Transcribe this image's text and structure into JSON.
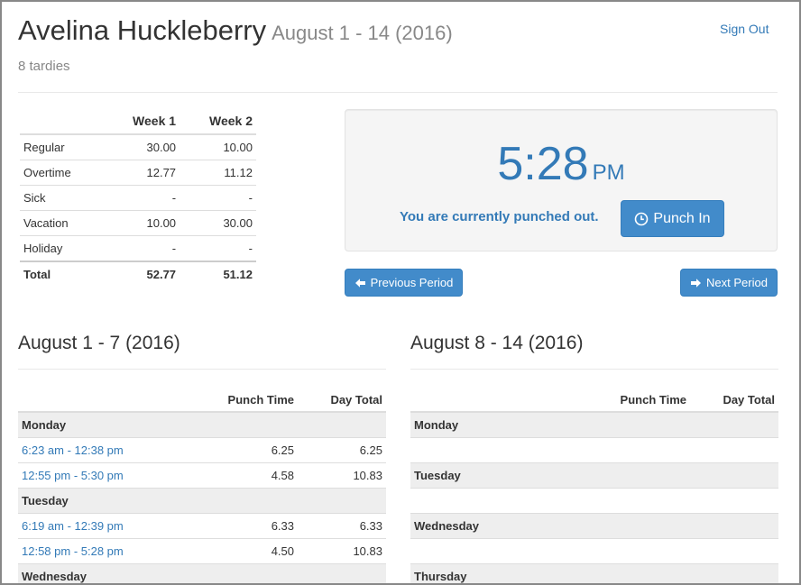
{
  "header": {
    "employee_name": "Avelina Huckleberry",
    "period": "August 1 - 14 (2016)",
    "tardies": "8 tardies",
    "sign_out": "Sign Out"
  },
  "summary": {
    "columns": [
      "",
      "Week 1",
      "Week 2"
    ],
    "rows": [
      {
        "label": "Regular",
        "w1": "30.00",
        "w2": "10.00"
      },
      {
        "label": "Overtime",
        "w1": "12.77",
        "w2": "11.12"
      },
      {
        "label": "Sick",
        "w1": "-",
        "w2": "-"
      },
      {
        "label": "Vacation",
        "w1": "10.00",
        "w2": "30.00"
      },
      {
        "label": "Holiday",
        "w1": "-",
        "w2": "-"
      }
    ],
    "total": {
      "label": "Total",
      "w1": "52.77",
      "w2": "51.12"
    }
  },
  "clock": {
    "time": "5:28",
    "ampm": "PM",
    "status": "You are currently punched out.",
    "punch_in_label": "Punch In"
  },
  "nav": {
    "previous": "Previous Period",
    "next": "Next Period"
  },
  "week1": {
    "title": "August 1 - 7 (2016)",
    "col_punch": "Punch Time",
    "col_day_total": "Day Total",
    "monday": "Monday",
    "mon_p1": {
      "range": "6:23 am - 12:38 pm",
      "punch": "6.25",
      "total": "6.25"
    },
    "mon_p2": {
      "range": "12:55 pm - 5:30 pm",
      "punch": "4.58",
      "total": "10.83"
    },
    "tuesday": "Tuesday",
    "tue_p1": {
      "range": "6:19 am - 12:39 pm",
      "punch": "6.33",
      "total": "6.33"
    },
    "tue_p2": {
      "range": "12:58 pm - 5:28 pm",
      "punch": "4.50",
      "total": "10.83"
    },
    "wednesday": "Wednesday"
  },
  "week2": {
    "title": "August 8 - 14 (2016)",
    "col_punch": "Punch Time",
    "col_day_total": "Day Total",
    "monday": "Monday",
    "tuesday": "Tuesday",
    "wednesday": "Wednesday",
    "thursday": "Thursday"
  },
  "colors": {
    "primary": "#428bca",
    "link": "#337ab7",
    "muted": "#888888",
    "day_row_bg": "#eeeeee"
  },
  "icons": {
    "punch": "clock-icon",
    "previous": "arrow-left-icon",
    "next": "arrow-right-icon"
  }
}
